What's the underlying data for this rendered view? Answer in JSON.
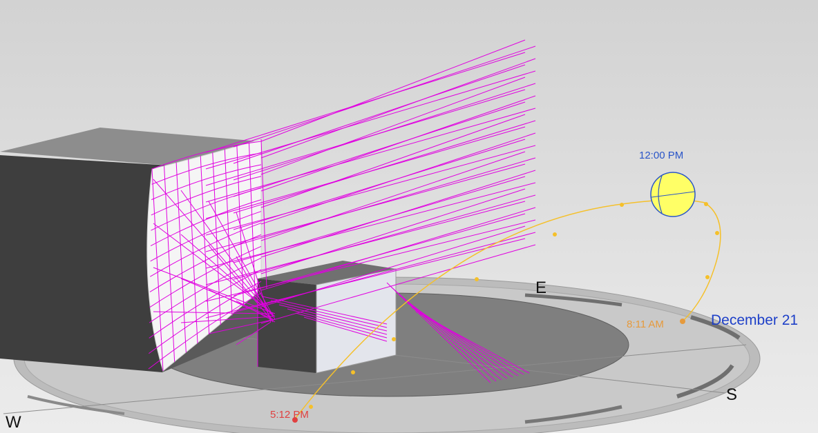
{
  "sun_path": {
    "date": "December 21",
    "time_sunrise": "8:11 AM",
    "time_noon": "12:00 PM",
    "time_sunset": "5:12 PM"
  },
  "compass": {
    "east": "E",
    "south": "S",
    "west": "W"
  },
  "colors": {
    "sun_path": "#f5c02a",
    "sun_fill": "#ffff66",
    "sun_outline": "#2a55c8",
    "rays": "#e000e0",
    "date_label": "#1e40c8",
    "sunrise_label": "#e69a3c",
    "sunset_label": "#e04040",
    "noon_label": "#2a55c8"
  },
  "icons": {
    "sun": "sun-icon"
  }
}
